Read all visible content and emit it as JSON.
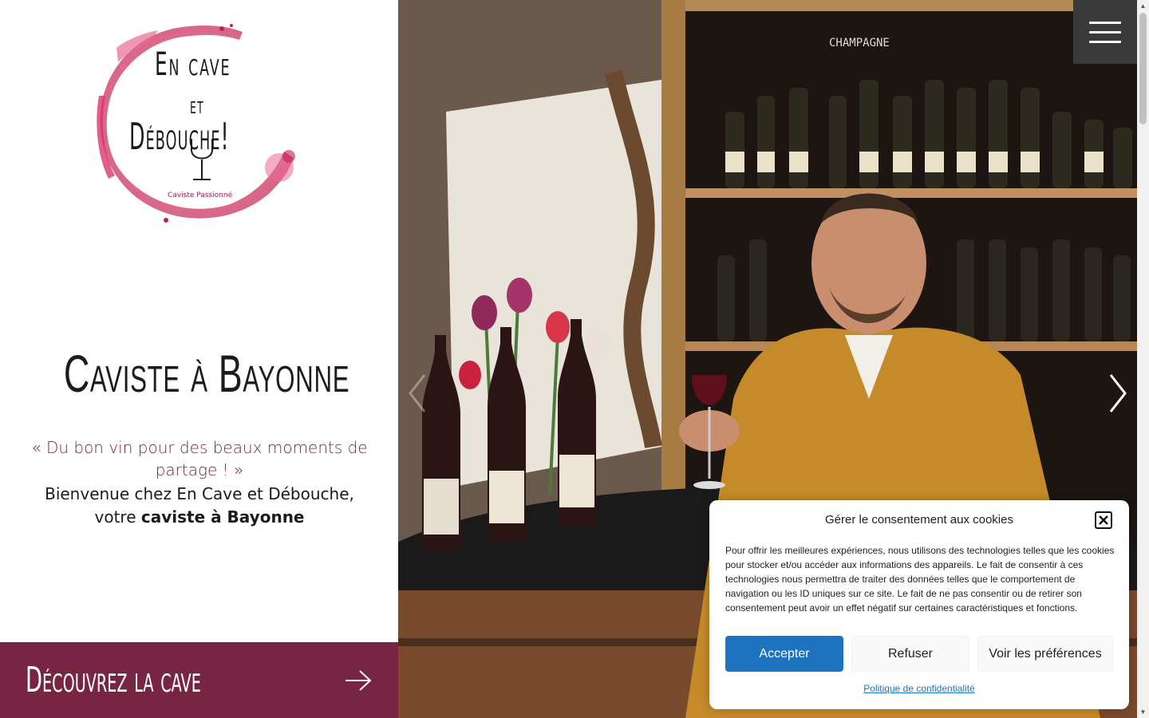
{
  "brand": {
    "logo_line1": "En cave",
    "logo_line2": "et",
    "logo_line3": "Débouche!",
    "tagline": "Caviste Passionné",
    "accent_color": "#782543"
  },
  "hero": {
    "title": "Caviste à Bayonne",
    "quote": "« Du bon vin pour des beaux moments de partage ! »",
    "welcome_line1": "Bienvenue chez En Cave et Débouche,",
    "welcome_prefix": "votre ",
    "welcome_strong": "caviste à Bayonne"
  },
  "cta": {
    "label": "Découvrez la cave",
    "icon": "arrow-right-icon"
  },
  "photo": {
    "shelf_label": "CHAMPAGNE"
  },
  "nav": {
    "menu_icon": "hamburger-icon"
  },
  "cookie_banner": {
    "title": "Gérer le consentement aux cookies",
    "body": "Pour offrir les meilleures expériences, nous utilisons des technologies telles que les cookies pour stocker et/ou accéder aux informations des appareils. Le fait de consentir à ces technologies nous permettra de traiter des données telles que le comportement de navigation ou les ID uniques sur ce site. Le fait de ne pas consentir ou de retirer son consentement peut avoir un effet négatif sur certaines caractéristiques et fonctions.",
    "accept_label": "Accepter",
    "refuse_label": "Refuser",
    "prefs_label": "Voir les préférences",
    "privacy_link": "Politique de confidentialité",
    "accept_color": "#1e73be"
  }
}
